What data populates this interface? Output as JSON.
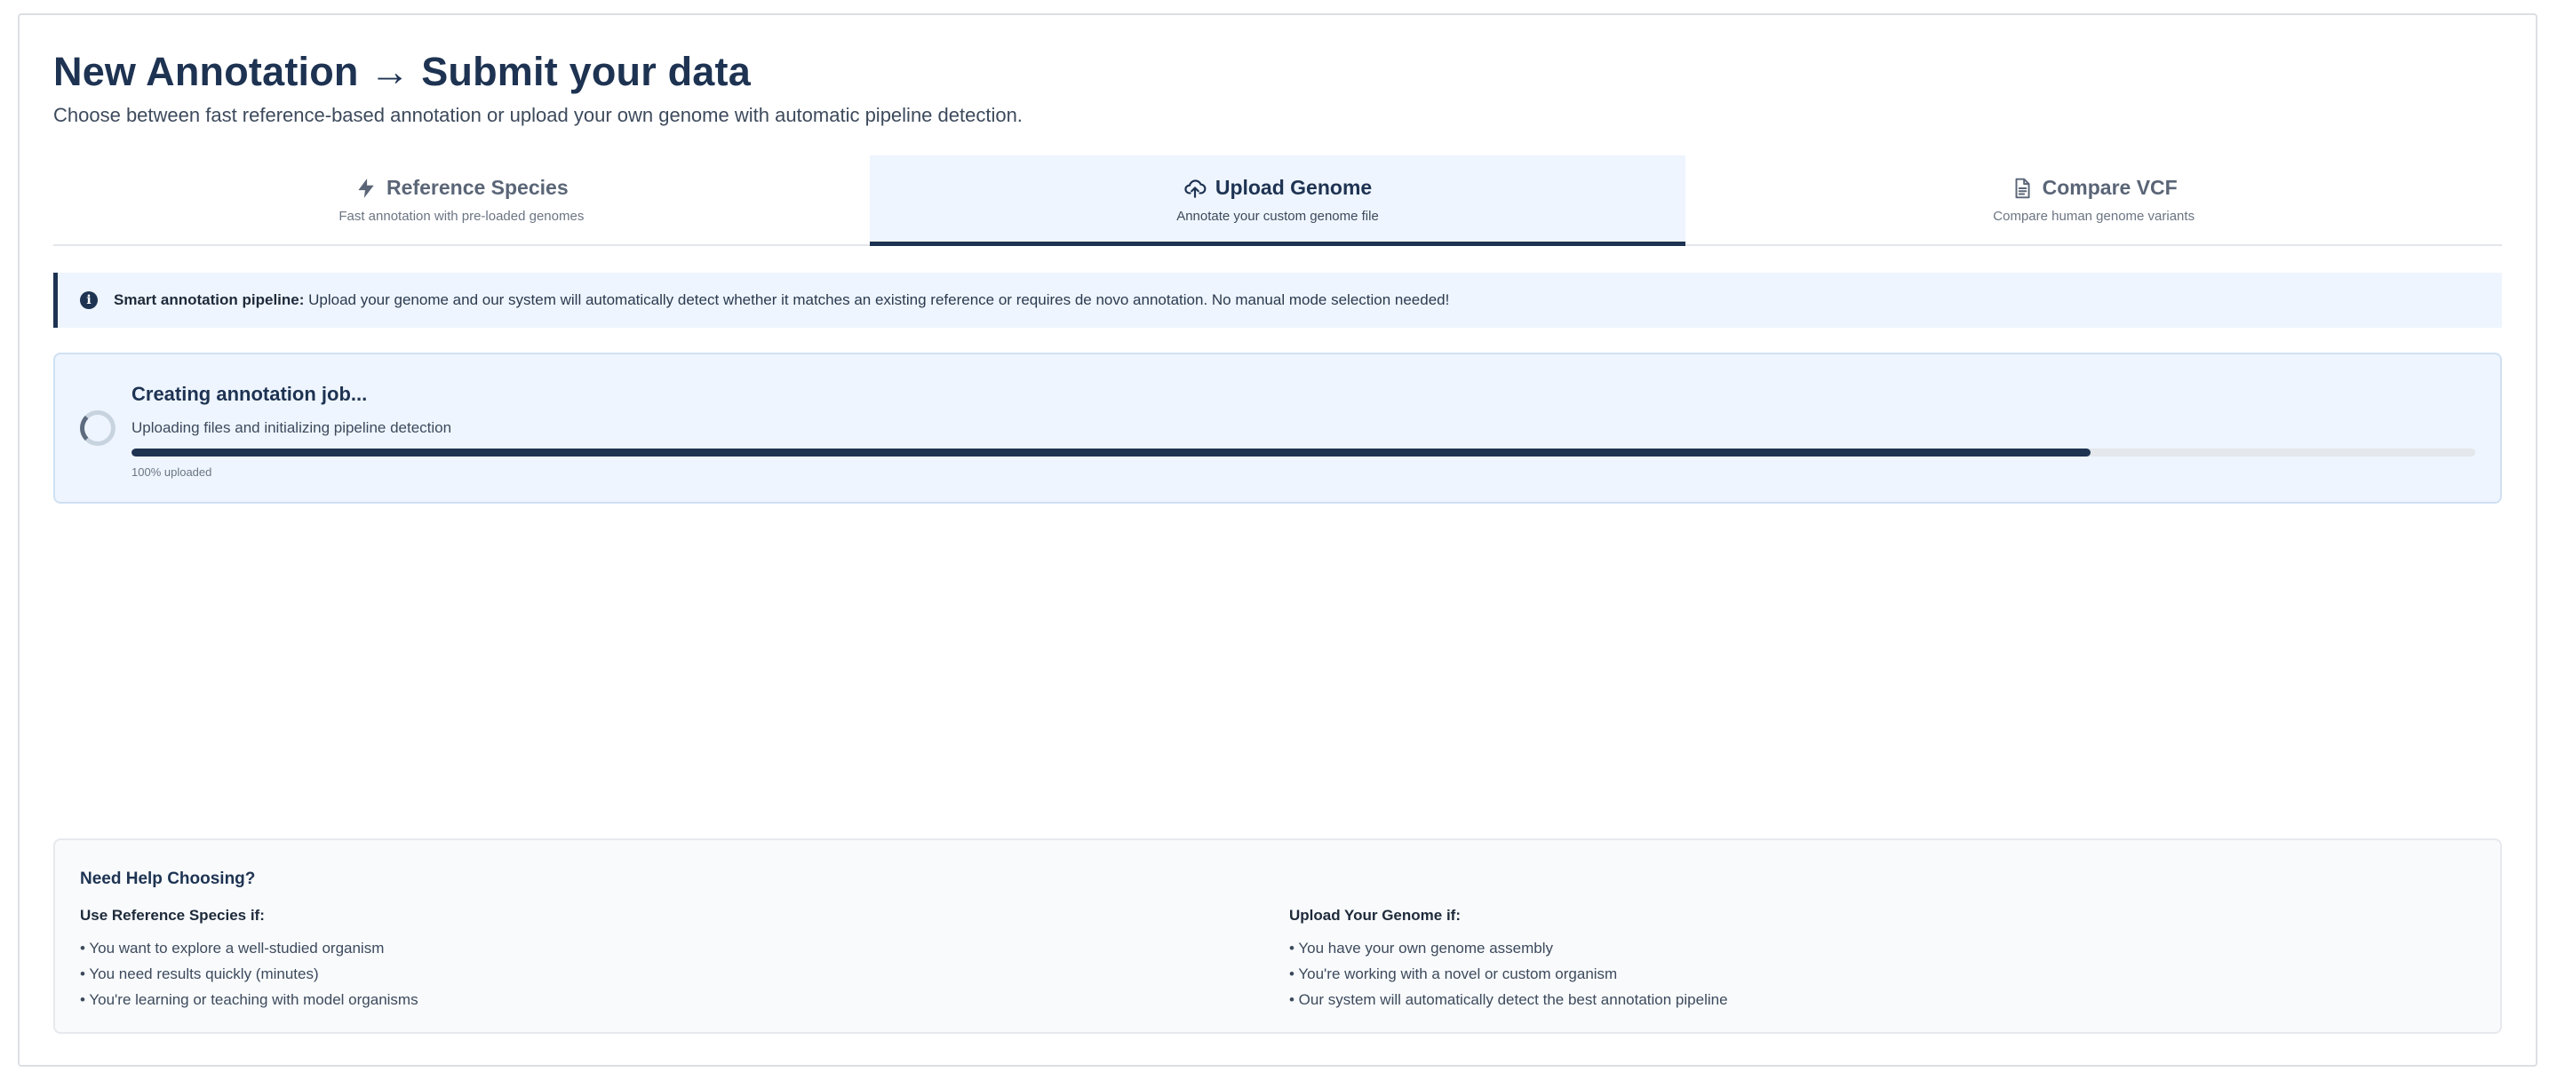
{
  "header": {
    "title": "New Annotation → Submit your data",
    "subtitle": "Choose between fast reference-based annotation or upload your own genome with automatic pipeline detection."
  },
  "tabs": [
    {
      "label": "Reference Species",
      "description": "Fast annotation with pre-loaded genomes",
      "icon": "lightning-icon",
      "active": false
    },
    {
      "label": "Upload Genome",
      "description": "Annotate your custom genome file",
      "icon": "cloud-upload-icon",
      "active": true
    },
    {
      "label": "Compare VCF",
      "description": "Compare human genome variants",
      "icon": "document-icon",
      "active": false
    }
  ],
  "info_banner": {
    "icon": "info-icon",
    "lead": "Smart annotation pipeline:",
    "text": " Upload your genome and our system will automatically detect whether it matches an existing reference or requires de novo annotation. No manual mode selection needed!"
  },
  "progress": {
    "title": "Creating annotation job...",
    "subtitle": "Uploading files and initializing pipeline detection",
    "fill_fraction": 0.836,
    "label": "100% uploaded"
  },
  "help": {
    "title": "Need Help Choosing?",
    "left": {
      "title": "Use Reference Species if:",
      "items": [
        "• You want to explore a well-studied organism",
        "• You need results quickly (minutes)",
        "• You're learning or teaching with model organisms"
      ]
    },
    "right": {
      "title": "Upload Your Genome if:",
      "items": [
        "• You have your own genome assembly",
        "• You're working with a novel or custom organism",
        "• Our system will automatically detect the best annotation pipeline"
      ]
    }
  },
  "colors": {
    "primary": "#1e3352",
    "active_tab_bg": "#eef5fe",
    "track": "#e4e7eb"
  }
}
